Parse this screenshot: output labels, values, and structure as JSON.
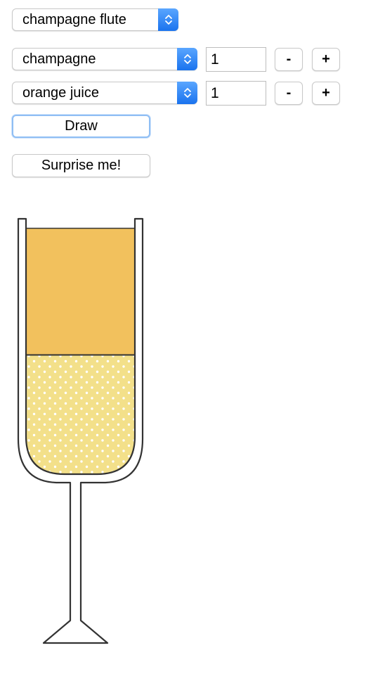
{
  "glass_select": {
    "value": "champagne flute"
  },
  "ingredients": [
    {
      "name": "champagne",
      "amount": "1",
      "minus": "-",
      "plus": "+"
    },
    {
      "name": "orange juice",
      "amount": "1",
      "minus": "-",
      "plus": "+"
    }
  ],
  "buttons": {
    "draw": "Draw",
    "surprise": "Surprise me!"
  },
  "drawing": {
    "glass_type": "champagne flute",
    "layers": [
      {
        "ingredient": "orange juice",
        "parts": 1,
        "color": "#f2c15d",
        "pattern": "solid"
      },
      {
        "ingredient": "champagne",
        "parts": 1,
        "color": "#f3e08a",
        "pattern": "bubbles"
      }
    ],
    "outline_color": "#333333",
    "accent_color": "#2b7ff3"
  }
}
